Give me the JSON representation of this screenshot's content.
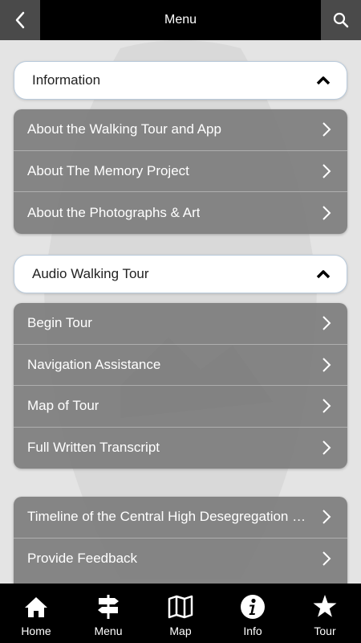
{
  "header": {
    "title": "Menu",
    "back_icon": "chevron-left-icon",
    "search_icon": "search-icon"
  },
  "sections": [
    {
      "title": "Information",
      "items": [
        {
          "label": "About the Walking Tour and App"
        },
        {
          "label": "About The Memory Project"
        },
        {
          "label": "About the Photographs & Art"
        }
      ]
    },
    {
      "title": "Audio Walking Tour",
      "items": [
        {
          "label": "Begin Tour"
        },
        {
          "label": "Navigation Assistance"
        },
        {
          "label": "Map of Tour"
        },
        {
          "label": "Full Written Transcript"
        }
      ]
    },
    {
      "items": [
        {
          "label": "Timeline of the Central High Desegregation Crisis"
        },
        {
          "label": "Provide Feedback"
        }
      ]
    }
  ],
  "tabs": [
    {
      "label": "Home",
      "icon": "home-icon"
    },
    {
      "label": "Menu",
      "icon": "signpost-icon"
    },
    {
      "label": "Map",
      "icon": "map-icon"
    },
    {
      "label": "Info",
      "icon": "info-icon"
    },
    {
      "label": "Tour",
      "icon": "star-icon"
    }
  ],
  "colors": {
    "bar_background": "#000000",
    "button_background": "#4a4a4a",
    "list_background": "#787878",
    "header_border": "#b9cadb"
  }
}
